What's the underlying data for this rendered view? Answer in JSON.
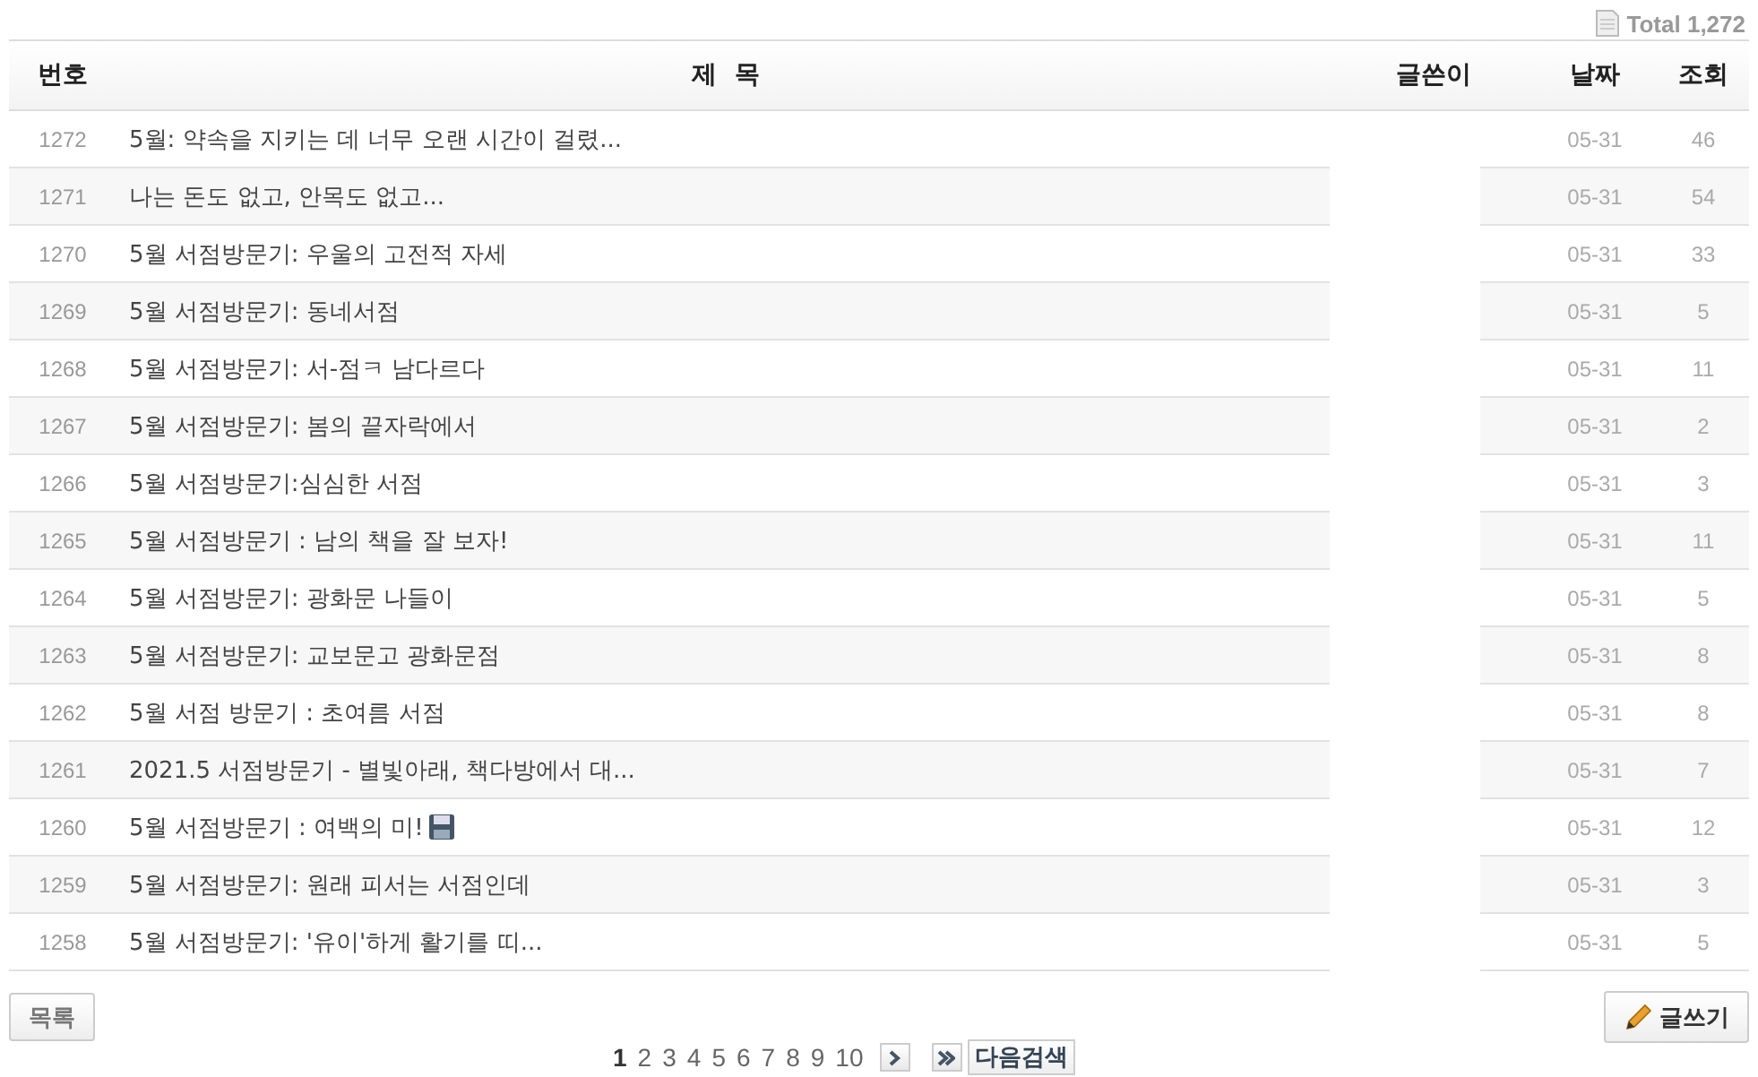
{
  "total": "Total 1,272",
  "columns": [
    "번호",
    "제  목",
    "글쓴이",
    "날짜",
    "조회"
  ],
  "posts": [
    {
      "number": "1272",
      "title": "5월: 약속을 지키는 데 너무 오랜 시간이 걸렸...",
      "attachment": false,
      "date": "05-31",
      "views": "46"
    },
    {
      "number": "1271",
      "title": "나는 돈도 없고, 안목도 없고...",
      "attachment": false,
      "date": "05-31",
      "views": "54"
    },
    {
      "number": "1270",
      "title": "5월 서점방문기: 우울의 고전적 자세",
      "attachment": false,
      "date": "05-31",
      "views": "33"
    },
    {
      "number": "1269",
      "title": "5월 서점방문기: 동네서점",
      "attachment": false,
      "date": "05-31",
      "views": "5"
    },
    {
      "number": "1268",
      "title": "5월 서점방문기: 서-점ㅋ 남다르다",
      "attachment": false,
      "date": "05-31",
      "views": "11"
    },
    {
      "number": "1267",
      "title": "5월 서점방문기: 봄의 끝자락에서",
      "attachment": false,
      "date": "05-31",
      "views": "2"
    },
    {
      "number": "1266",
      "title": "5월 서점방문기:심심한 서점",
      "attachment": false,
      "date": "05-31",
      "views": "3"
    },
    {
      "number": "1265",
      "title": "5월 서점방문기 : 남의 책을 잘 보자!",
      "attachment": false,
      "date": "05-31",
      "views": "11"
    },
    {
      "number": "1264",
      "title": "5월 서점방문기: 광화문 나들이",
      "attachment": false,
      "date": "05-31",
      "views": "5"
    },
    {
      "number": "1263",
      "title": "5월 서점방문기: 교보문고 광화문점",
      "attachment": false,
      "date": "05-31",
      "views": "8"
    },
    {
      "number": "1262",
      "title": "5월 서점 방문기 : 초여름 서점",
      "attachment": false,
      "date": "05-31",
      "views": "8"
    },
    {
      "number": "1261",
      "title": "2021.5 서점방문기 - 별빛아래, 책다방에서 대...",
      "attachment": false,
      "date": "05-31",
      "views": "7"
    },
    {
      "number": "1260",
      "title": "5월 서점방문기 : 여백의 미!",
      "attachment": true,
      "date": "05-31",
      "views": "12"
    },
    {
      "number": "1259",
      "title": "5월 서점방문기: 원래 피서는 서점인데",
      "attachment": false,
      "date": "05-31",
      "views": "3"
    },
    {
      "number": "1258",
      "title": "5월 서점방문기: '유이'하게 활기를 띠...",
      "attachment": false,
      "date": "05-31",
      "views": "5"
    }
  ],
  "list_button": "목록",
  "write_button": "글쓰기",
  "pagination": {
    "pages": [
      {
        "label": "1",
        "selected": true
      },
      {
        "label": "2",
        "selected": false
      },
      {
        "label": "3",
        "selected": false
      },
      {
        "label": "4",
        "selected": false
      },
      {
        "label": "5",
        "selected": false
      },
      {
        "label": "6",
        "selected": false
      },
      {
        "label": "7",
        "selected": false
      },
      {
        "label": "8",
        "selected": false
      },
      {
        "label": "9",
        "selected": false
      },
      {
        "label": "10",
        "selected": false
      }
    ],
    "search_next": "다음검색"
  }
}
